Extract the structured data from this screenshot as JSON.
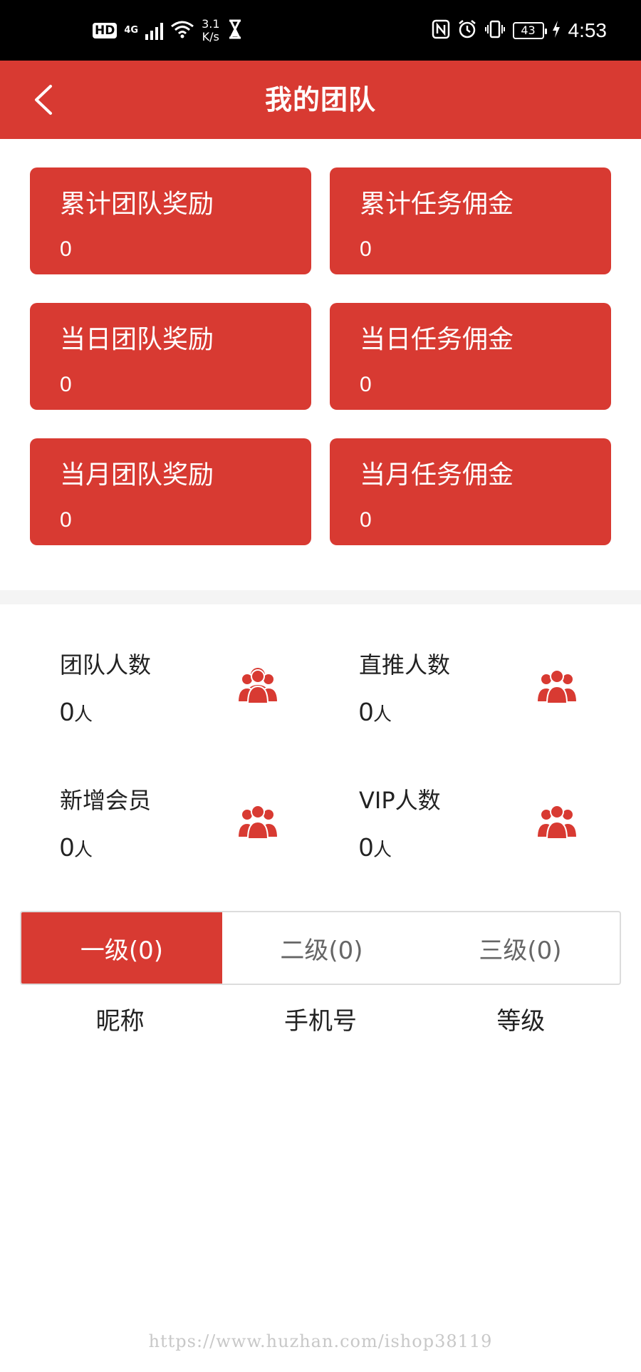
{
  "status_bar": {
    "hd": "HD",
    "network": "4G",
    "speed_value": "3.1",
    "speed_unit": "K/s",
    "battery": "43",
    "time": "4:53"
  },
  "header": {
    "title": "我的团队",
    "background": "#d83a32"
  },
  "stats": [
    {
      "label": "累计团队奖励",
      "value": "0"
    },
    {
      "label": "累计任务佣金",
      "value": "0"
    },
    {
      "label": "当日团队奖励",
      "value": "0"
    },
    {
      "label": "当日任务佣金",
      "value": "0"
    },
    {
      "label": "当月团队奖励",
      "value": "0"
    },
    {
      "label": "当月任务佣金",
      "value": "0"
    }
  ],
  "members": [
    {
      "label": "团队人数",
      "count": "0",
      "unit": "人",
      "icon": "team-icon"
    },
    {
      "label": "直推人数",
      "count": "0",
      "unit": "人",
      "icon": "team-icon"
    },
    {
      "label": "新增会员",
      "count": "0",
      "unit": "人",
      "icon": "team-icon"
    },
    {
      "label": "VIP人数",
      "count": "0",
      "unit": "人",
      "icon": "team-icon"
    }
  ],
  "tabs": [
    {
      "label": "一级(0)",
      "active": true
    },
    {
      "label": "二级(0)",
      "active": false
    },
    {
      "label": "三级(0)",
      "active": false
    }
  ],
  "columns": [
    "昵称",
    "手机号",
    "等级"
  ],
  "watermark": "https://www.huzhan.com/ishop38119",
  "colors": {
    "accent": "#d83a32",
    "text": "#222222",
    "tab_inactive_text": "#666666"
  }
}
